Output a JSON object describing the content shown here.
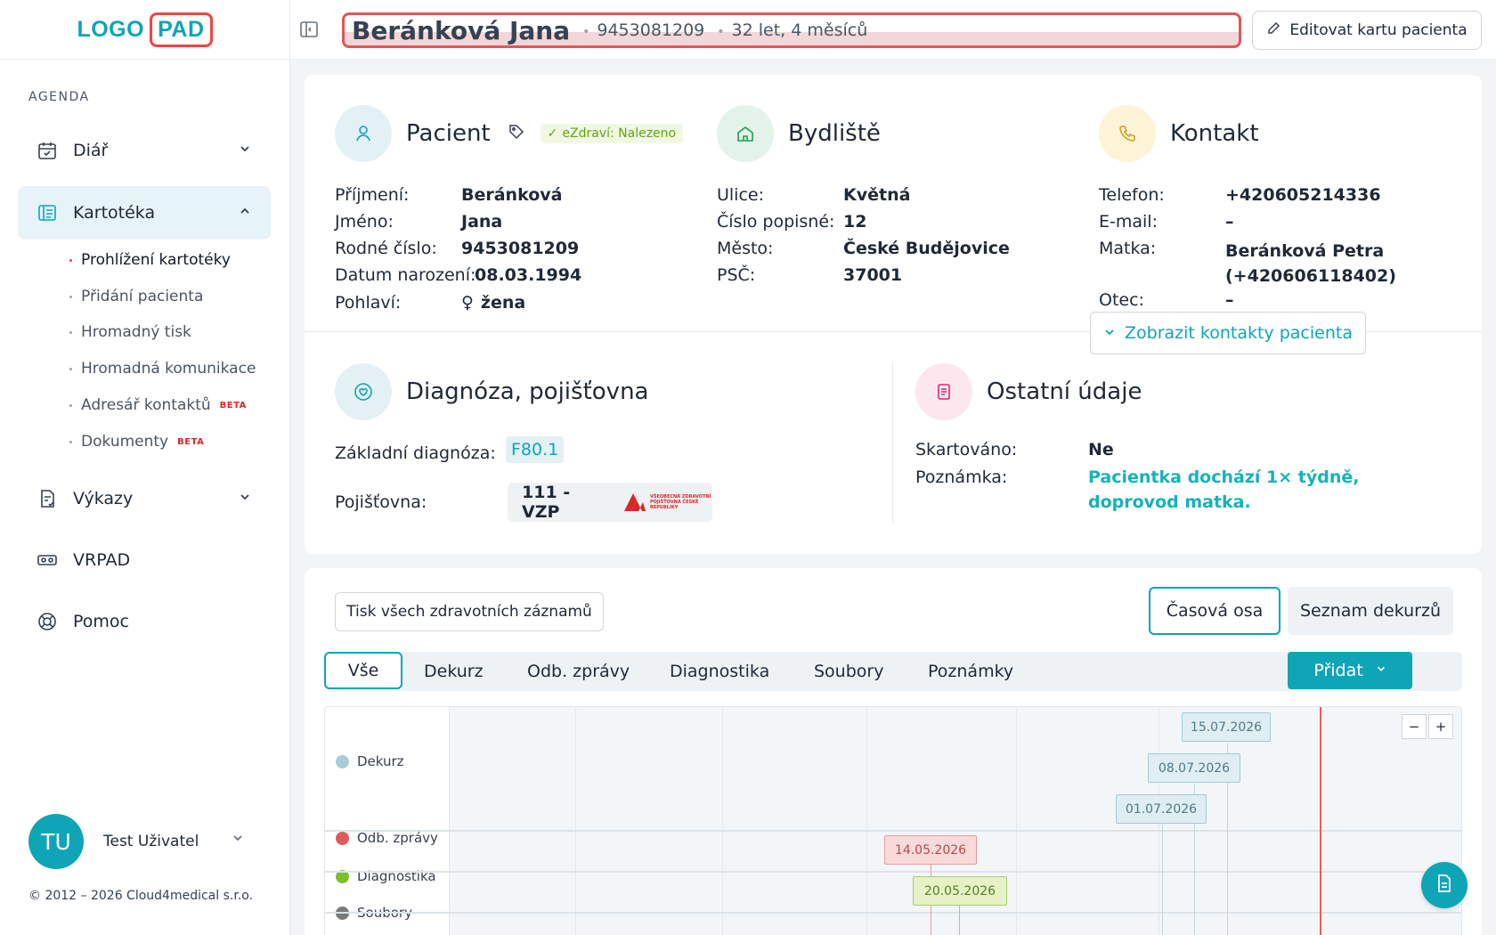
{
  "logo": {
    "part1": "LOGO",
    "part2": "PAD"
  },
  "sidebar": {
    "section": "AGENDA",
    "items": [
      {
        "label": "Diář",
        "icon": "calendar-check-icon"
      },
      {
        "label": "Kartotéka",
        "icon": "card-index-icon"
      },
      {
        "label": "Výkazy",
        "icon": "report-icon"
      },
      {
        "label": "VRPAD",
        "icon": "vr-headset-icon"
      },
      {
        "label": "Pomoc",
        "icon": "lifebuoy-icon"
      }
    ],
    "subitems": [
      {
        "label": "Prohlížení kartotéky"
      },
      {
        "label": "Přidání pacienta"
      },
      {
        "label": "Hromadný tisk"
      },
      {
        "label": "Hromadná komunikace"
      },
      {
        "label": "Adresář kontaktů",
        "badge": "BETA"
      },
      {
        "label": "Dokumenty",
        "badge": "BETA"
      }
    ],
    "user": {
      "initials": "TU",
      "name": "Test Uživatel"
    },
    "copyright": "© 2012 – 2026 Cloud4medical s.r.o."
  },
  "topbar": {
    "patient_name": "Beránková Jana",
    "birth_number": "9453081209",
    "age": "32 let, 4 měsíců",
    "edit_label": "Editovat kartu pacienta"
  },
  "patient": {
    "title": "Pacient",
    "badge": "eZdraví: Nalezeno",
    "fields": [
      {
        "k": "Příjmení:",
        "v": "Beránková"
      },
      {
        "k": "Jméno:",
        "v": "Jana"
      },
      {
        "k": "Rodné číslo:",
        "v": "9453081209"
      },
      {
        "k": "Datum narození:",
        "v": "08.03.1994"
      },
      {
        "k": "Pohlaví:",
        "v": "žena"
      }
    ]
  },
  "residence": {
    "title": "Bydliště",
    "fields": [
      {
        "k": "Ulice:",
        "v": "Květná"
      },
      {
        "k": "Číslo popisné:",
        "v": "12"
      },
      {
        "k": "Město:",
        "v": "České Budějovice"
      },
      {
        "k": "PSČ:",
        "v": "37001"
      }
    ]
  },
  "contact": {
    "title": "Kontakt",
    "fields": [
      {
        "k": "Telefon:",
        "v": "+420605214336"
      },
      {
        "k": "E-mail:",
        "v": "–"
      },
      {
        "k": "Matka:",
        "v": "Beránková Petra",
        "v2": "(+420606118402)"
      },
      {
        "k": "Otec:",
        "v": "–"
      }
    ],
    "show_more": "Zobrazit kontakty pacienta"
  },
  "diagnosis": {
    "title": "Diagnóza, pojišťovna",
    "base_label": "Základní diagnóza:",
    "base_code": "F80.1",
    "insurer_label": "Pojišťovna:",
    "insurer": "111 - VZP",
    "insurer_logo_text": "VŠEOBECNÁ ZDRAVOTNÍ POJIŠŤOVNA ČESKÉ REPUBLIKY"
  },
  "other": {
    "title": "Ostatní údaje",
    "shredded_label": "Skartováno:",
    "shredded": "Ne",
    "note_label": "Poznámka:",
    "note": "Pacientka dochází 1× týdně, doprovod matka."
  },
  "records": {
    "print_all": "Tisk všech zdravotních záznamů",
    "views": [
      "Časová osa",
      "Seznam dekurzů"
    ],
    "tabs": [
      "Vše",
      "Dekurz",
      "Odb. zprávy",
      "Diagnostika",
      "Soubory",
      "Poznámky"
    ],
    "add_label": "Přidat",
    "lanes": [
      {
        "label": "Dekurz",
        "color": "#a7cdd9"
      },
      {
        "label": "Odb. zprávy",
        "color": "#e05a5a"
      },
      {
        "label": "Diagnostika",
        "color": "#7cbf2e"
      },
      {
        "label": "Soubory",
        "color": "#7a7a7a"
      }
    ],
    "events": [
      {
        "lane": "Dekurz",
        "date": "15.07.2026"
      },
      {
        "lane": "Dekurz",
        "date": "08.07.2026"
      },
      {
        "lane": "Dekurz",
        "date": "01.07.2026"
      },
      {
        "lane": "Odb. zprávy",
        "date": "14.05.2026"
      },
      {
        "lane": "Diagnostika",
        "date": "20.05.2026"
      }
    ],
    "zoom_out": "−",
    "zoom_in": "+"
  },
  "colors": {
    "accent": "#0ea5b7",
    "highlight": "#ef4444"
  }
}
